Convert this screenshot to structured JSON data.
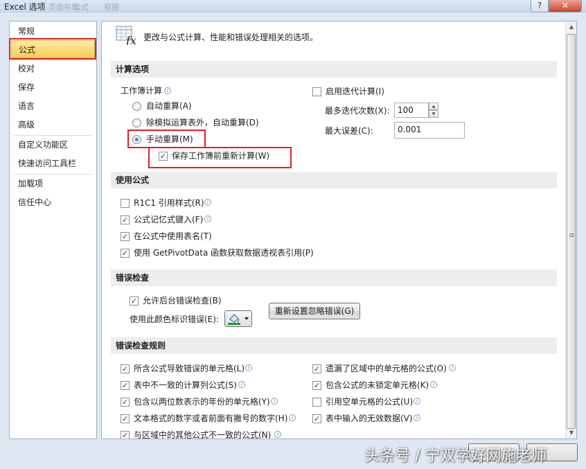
{
  "window": {
    "title": "Excel 选项",
    "ghost_tabs": [
      "页面布局",
      "公式",
      "视图"
    ],
    "help_label": "?",
    "close_label": "✕"
  },
  "sidebar": {
    "items": [
      {
        "label": "常规"
      },
      {
        "label": "公式",
        "selected": true
      },
      {
        "label": "校对"
      },
      {
        "label": "保存"
      },
      {
        "label": "语言"
      },
      {
        "label": "高级"
      },
      {
        "label": "自定义功能区"
      },
      {
        "label": "快速访问工具栏"
      },
      {
        "label": "加载项"
      },
      {
        "label": "信任中心"
      }
    ]
  },
  "header": {
    "icon": "formula-fx-icon",
    "text": "更改与公式计算、性能和错误处理相关的选项。"
  },
  "calc": {
    "section_title": "计算选项",
    "workbook_calc_label": "工作簿计算",
    "auto": "自动重算(A)",
    "auto_except_tables": "除模拟运算表外，自动重算(D)",
    "manual": "手动重算(M)",
    "manual_selected": true,
    "recalc_before_save": "保存工作簿前重新计算(W)",
    "recalc_before_save_checked": true,
    "iterative": "启用迭代计算(I)",
    "iterative_checked": false,
    "max_iterations_label": "最多迭代次数(X):",
    "max_iterations_value": "100",
    "max_change_label": "最大误差(C):",
    "max_change_value": "0.001"
  },
  "formulas": {
    "section_title": "使用公式",
    "r1c1": "R1C1 引用样式(R)",
    "r1c1_checked": false,
    "autocomplete": "公式记忆式键入(F)",
    "autocomplete_checked": true,
    "table_names": "在公式中使用表名(T)",
    "table_names_checked": true,
    "getpivotdata": "使用 GetPivotData 函数获取数据透视表引用(P)",
    "getpivotdata_checked": true
  },
  "error_checking": {
    "section_title": "错误检查",
    "background": "允许后台错误检查(B)",
    "background_checked": true,
    "color_label": "使用此颜色标识错误(E):",
    "color": "#0f9d3a",
    "reset_button": "重新设置忽略错误(G)"
  },
  "error_rules": {
    "section_title": "错误检查规则",
    "left": [
      {
        "label": "所含公式导致错误的单元格(L)",
        "checked": true
      },
      {
        "label": "表中不一致的计算列公式(S)",
        "checked": true
      },
      {
        "label": "包含以两位数表示的年份的单元格(Y)",
        "checked": true
      },
      {
        "label": "文本格式的数字或者前面有撇号的数字(H)",
        "checked": true
      },
      {
        "label": "与区域中的其他公式不一致的公式(N)",
        "checked": true
      }
    ],
    "right": [
      {
        "label": "遗漏了区域中的单元格的公式(O)",
        "checked": true
      },
      {
        "label": "包含公式的未锁定单元格(K)",
        "checked": true
      },
      {
        "label": "引用空单元格的公式(U)",
        "checked": false
      },
      {
        "label": "表中输入的无效数据(V)",
        "checked": true
      }
    ]
  },
  "watermark": "头条号 / 宁双学好网施老师"
}
